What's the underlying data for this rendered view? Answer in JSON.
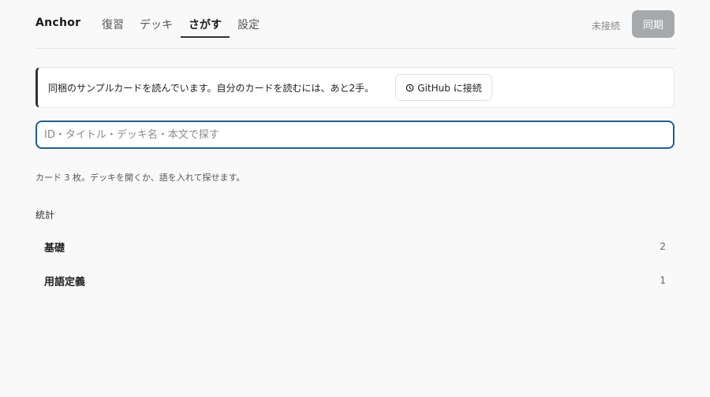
{
  "header": {
    "brand": "Anchor",
    "tabs": [
      {
        "label": "復習",
        "active": false
      },
      {
        "label": "デッキ",
        "active": false
      },
      {
        "label": "さがす",
        "active": true
      },
      {
        "label": "設定",
        "active": false
      }
    ],
    "connection_status": "未接続",
    "sync_label": "同期"
  },
  "notice": {
    "text": "同梱のサンプルカードを読んでいます。自分のカードを読むには、あと2手。",
    "github_button_label": "GitHub に接続",
    "github_icon": "clock-icon"
  },
  "search": {
    "placeholder": "ID・タイトル・デッキ名・本文で探す",
    "value": ""
  },
  "hint": "カード 3 枚。デッキを開くか、語を入れて探せます。",
  "stats": {
    "title": "統計",
    "decks": [
      {
        "name": "基礎",
        "count": "2"
      },
      {
        "name": "用語定義",
        "count": "1"
      }
    ]
  },
  "colors": {
    "accent_border": "#1f5f8f",
    "sync_button": "#a6a9ac",
    "notice_bar": "#2e3338"
  }
}
